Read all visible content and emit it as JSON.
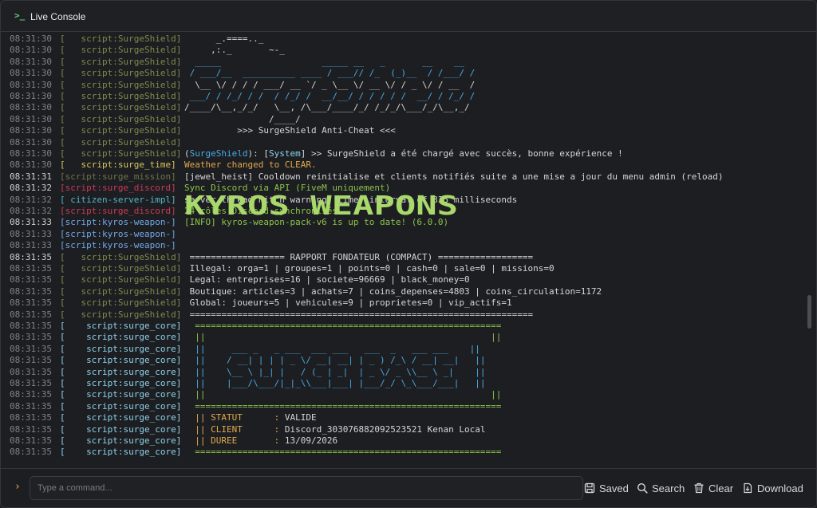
{
  "window": {
    "title": "Live Console",
    "icon": "terminal-icon"
  },
  "colors": {
    "timestamp": "#7f8187",
    "surgeshield": "#7f8a4b",
    "surge_time": "#d6c85a",
    "surge_mission": "#6f7448",
    "surge_discord": "#c93b56",
    "citizen": "#55b7c0",
    "kyros": "#73a8e8",
    "surge_core": "#8dd2e9",
    "ascii_blue": "#49a9e3",
    "green_text": "#8bc34a",
    "accent": "#e0a94a"
  },
  "log": [
    {
      "ts": "08:31:30",
      "src": "[   script:SurgeShield]",
      "srcColor": "#7f8a4b",
      "msg": "      _.====.._",
      "msgColor": "#d6d6d6"
    },
    {
      "ts": "08:31:30",
      "src": "[   script:SurgeShield]",
      "srcColor": "#7f8a4b",
      "msg": "     ,:._       ~-_",
      "msgColor": "#d6d6d6"
    },
    {
      "ts": "08:31:30",
      "src": "[   script:SurgeShield]",
      "srcColor": "#7f8a4b",
      "msg": "  _____                   _____ __   _       __    __",
      "msgColor": "#49a9e3"
    },
    {
      "ts": "08:31:30",
      "src": "[   script:SurgeShield]",
      "srcColor": "#7f8a4b",
      "msg": " / ___/__  __________ ____ / ___// /_  (_)__  / /___/ /",
      "msgColor": "#49a9e3"
    },
    {
      "ts": "08:31:30",
      "src": "[   script:SurgeShield]",
      "srcColor": "#7f8a4b",
      "msg": "  \\__ \\/ / / / ___/ __ `/ _ \\__ \\/ __ \\/ / _ \\/ / __  /",
      "msgColor": "#d6d6d6"
    },
    {
      "ts": "08:31:30",
      "src": "[   script:SurgeShield]",
      "srcColor": "#7f8a4b",
      "msg": " ___/ / /_/ / /  / /_/ /  __/__/ / / / / /  __/ / /_/ /",
      "msgColor": "#49a9e3"
    },
    {
      "ts": "08:31:30",
      "src": "[   script:SurgeShield]",
      "srcColor": "#7f8a4b",
      "msg": "/____/\\__,_/_/   \\__, /\\___/____/_/ /_/_/\\___/_/\\__,_/",
      "msgColor": "#d6d6d6"
    },
    {
      "ts": "08:31:30",
      "src": "[   script:SurgeShield]",
      "srcColor": "#7f8a4b",
      "msg": "                /____/",
      "msgColor": "#d6d6d6"
    },
    {
      "ts": "08:31:30",
      "src": "[   script:SurgeShield]",
      "srcColor": "#7f8a4b",
      "msg": "          >>> SurgeShield Anti-Cheat <<<",
      "msgColor": "#d6d6d6"
    },
    {
      "ts": "08:31:30",
      "src": "[   script:SurgeShield]",
      "srcColor": "#7f8a4b",
      "msg": "",
      "msgColor": "#d6d6d6"
    },
    {
      "ts": "08:31:30",
      "src": "[   script:SurgeShield]",
      "srcColor": "#7f8a4b",
      "msg": "(SurgeShield): [System] >> SurgeShield a été chargé avec succès, bonne expérience !",
      "msgColor": "#d6d6d6",
      "rich": "surgeshield"
    },
    {
      "ts": "08:31:30",
      "src": "[   script:surge_time]",
      "srcColor": "#d6c85a",
      "msg": "Weather changed to CLEAR.",
      "msgColor": "#e0a94a"
    },
    {
      "ts": "08:31:31",
      "src": "[script:surge_mission]",
      "srcColor": "#6f7448",
      "msg": "[jewel_heist] Cooldown reinitialise et clients notifiés suite a une mise a jour du menu admin (reload)",
      "msgColor": "#d6d6d6",
      "hi": true
    },
    {
      "ts": "08:31:32",
      "src": "[script:surge_discord]",
      "srcColor": "#c93b56",
      "msg": "Sync Discord via API (FiveM uniquement)",
      "msgColor": "#8bc34a",
      "hi": true
    },
    {
      "ts": "08:31:32",
      "src": "[ citizen-server-impl]",
      "srcColor": "#55b7c0",
      "msg": "server thread hitch warning: timer interval of 335 milliseconds",
      "msgColor": "#d6d6d6"
    },
    {
      "ts": "08:31:32",
      "src": "[script:surge_discord]",
      "srcColor": "#c93b56",
      "msg": "24 rôles Discord synchronisés",
      "msgColor": "#8bc34a"
    },
    {
      "ts": "08:31:33",
      "src": "[script:kyros-weapon-]",
      "srcColor": "#73a8e8",
      "msg": "[INFO] kyros-weapon-pack-v6 is up to date! (6.0.0)",
      "msgColor": "#8bc34a",
      "hi": true
    },
    {
      "ts": "08:31:33",
      "src": "[script:kyros-weapon-]",
      "srcColor": "#73a8e8",
      "msg": "",
      "msgColor": "#d6d6d6"
    },
    {
      "ts": "08:31:33",
      "src": "[script:kyros-weapon-]",
      "srcColor": "#73a8e8",
      "msg": "",
      "msgColor": "#d6d6d6"
    },
    {
      "ts": "08:31:35",
      "src": "[   script:SurgeShield]",
      "srcColor": "#7f8a4b",
      "msg": " ================== RAPPORT FONDATEUR (COMPACT) ==================",
      "msgColor": "#d6d6d6",
      "hi": true
    },
    {
      "ts": "08:31:35",
      "src": "[   script:SurgeShield]",
      "srcColor": "#7f8a4b",
      "msg": " Illegal: orga=1 | groupes=1 | points=0 | cash=0 | sale=0 | missions=0",
      "msgColor": "#d6d6d6"
    },
    {
      "ts": "08:31:35",
      "src": "[   script:SurgeShield]",
      "srcColor": "#7f8a4b",
      "msg": " Legal: entreprises=16 | societe=96669 | black_money=0",
      "msgColor": "#d6d6d6"
    },
    {
      "ts": "08:31:35",
      "src": "[   script:SurgeShield]",
      "srcColor": "#7f8a4b",
      "msg": " Boutique: articles=3 | achats=7 | coins_depenses=4803 | coins_circulation=1172",
      "msgColor": "#d6d6d6"
    },
    {
      "ts": "08:31:35",
      "src": "[   script:SurgeShield]",
      "srcColor": "#7f8a4b",
      "msg": " Global: joueurs=5 | vehicules=9 | proprietes=0 | vip_actifs=1",
      "msgColor": "#d6d6d6"
    },
    {
      "ts": "08:31:35",
      "src": "[   script:SurgeShield]",
      "srcColor": "#7f8a4b",
      "msg": " =================================================================",
      "msgColor": "#d6d6d6"
    },
    {
      "ts": "08:31:35",
      "src": "[    script:surge_core]",
      "srcColor": "#8dd2e9",
      "msg": "  ==========================================================",
      "msgColor": "#8bc34a"
    },
    {
      "ts": "08:31:35",
      "src": "[    script:surge_core]",
      "srcColor": "#8dd2e9",
      "msg": "  ||                                                      ||",
      "msgColor": "#8bc34a"
    },
    {
      "ts": "08:31:35",
      "src": "[    script:surge_core]",
      "srcColor": "#8dd2e9",
      "msg": "  ||     ___ _   _ ___  ___ ___   ___  _   ___ ___    ||",
      "msgColor": "#49a9e3"
    },
    {
      "ts": "08:31:35",
      "src": "[    script:surge_core]",
      "srcColor": "#8dd2e9",
      "msg": "  ||    / __| | | | _ \\/ __| __| | _ ) /_\\ / __| __|   ||",
      "msgColor": "#49a9e3"
    },
    {
      "ts": "08:31:35",
      "src": "[    script:surge_core]",
      "srcColor": "#8dd2e9",
      "msg": "  ||    \\__ \\ |_| |   / (_ | _|  | _ \\/ _ \\\\__ \\ _|    ||",
      "msgColor": "#49a9e3"
    },
    {
      "ts": "08:31:35",
      "src": "[    script:surge_core]",
      "srcColor": "#8dd2e9",
      "msg": "  ||    |___/\\___/|_|_\\\\___|___| |___/_/ \\_\\___/___|   ||",
      "msgColor": "#49a9e3"
    },
    {
      "ts": "08:31:35",
      "src": "[    script:surge_core]",
      "srcColor": "#8dd2e9",
      "msg": "  ||                                                      ||",
      "msgColor": "#8bc34a"
    },
    {
      "ts": "08:31:35",
      "src": "[    script:surge_core]",
      "srcColor": "#8dd2e9",
      "msg": "  ==========================================================",
      "msgColor": "#8bc34a"
    },
    {
      "ts": "08:31:35",
      "src": "[    script:surge_core]",
      "srcColor": "#8dd2e9",
      "msg": "  || STATUT      : VALIDE",
      "msgColor": "#d6d6d6",
      "kv": true
    },
    {
      "ts": "08:31:35",
      "src": "[    script:surge_core]",
      "srcColor": "#8dd2e9",
      "msg": "  || CLIENT      : Discord_303076882092523521 Kenan Local",
      "msgColor": "#d6d6d6",
      "kv": true
    },
    {
      "ts": "08:31:35",
      "src": "[    script:surge_core]",
      "srcColor": "#8dd2e9",
      "msg": "  || DUREE       : 13/09/2026",
      "msgColor": "#d6d6d6",
      "kv": true
    },
    {
      "ts": "08:31:35",
      "src": "[    script:surge_core]",
      "srcColor": "#8dd2e9",
      "msg": "  ==========================================================",
      "msgColor": "#8bc34a"
    }
  ],
  "banner": {
    "text": "KYROS WEAPONS",
    "color": "#a8d96a"
  },
  "command": {
    "prompt": "›",
    "placeholder": "Type a command..."
  },
  "toolbar": {
    "saved_label": "Saved",
    "search_label": "Search",
    "clear_label": "Clear",
    "download_label": "Download"
  }
}
